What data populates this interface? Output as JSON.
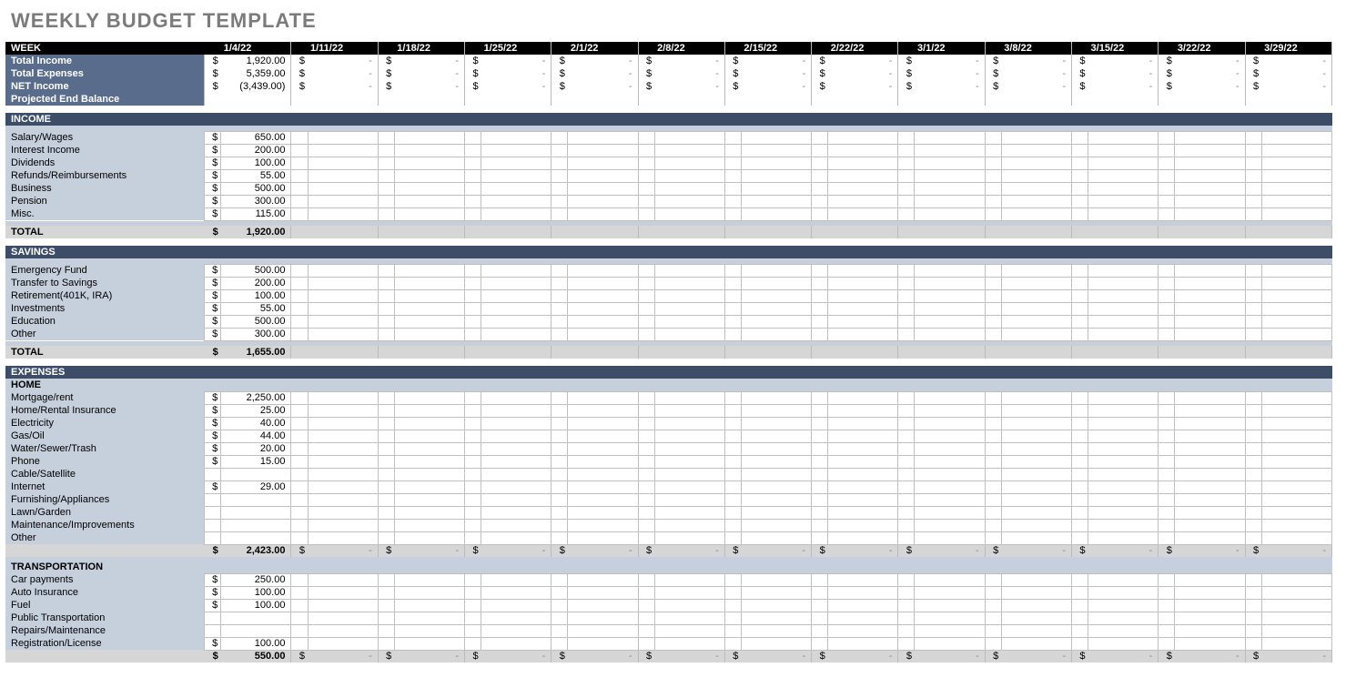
{
  "title": "WEEKLY BUDGET TEMPLATE",
  "weeks": [
    "1/4/22",
    "1/11/22",
    "1/18/22",
    "1/25/22",
    "2/1/22",
    "2/8/22",
    "2/15/22",
    "2/22/22",
    "3/1/22",
    "3/8/22",
    "3/15/22",
    "3/22/22",
    "3/29/22"
  ],
  "summary": {
    "week": "WEEK",
    "rows": [
      {
        "label": "Total Income",
        "vals": [
          "1,920.00",
          "-",
          "-",
          "-",
          "-",
          "-",
          "-",
          "-",
          "-",
          "-",
          "-",
          "-",
          "-"
        ]
      },
      {
        "label": "Total Expenses",
        "vals": [
          "5,359.00",
          "-",
          "-",
          "-",
          "-",
          "-",
          "-",
          "-",
          "-",
          "-",
          "-",
          "-",
          "-"
        ]
      },
      {
        "label": "NET Income",
        "vals": [
          "(3,439.00)",
          "-",
          "-",
          "-",
          "-",
          "-",
          "-",
          "-",
          "-",
          "-",
          "-",
          "-",
          "-"
        ]
      },
      {
        "label": "Projected End Balance"
      }
    ]
  },
  "sections": [
    {
      "title": "INCOME",
      "rows": [
        {
          "label": "Salary/Wages",
          "val": "650.00"
        },
        {
          "label": "Interest Income",
          "val": "200.00"
        },
        {
          "label": "Dividends",
          "val": "100.00"
        },
        {
          "label": "Refunds/Reimbursements",
          "val": "55.00"
        },
        {
          "label": "Business",
          "val": "500.00"
        },
        {
          "label": "Pension",
          "val": "300.00"
        },
        {
          "label": "Misc.",
          "val": "115.00"
        }
      ],
      "total_label": "TOTAL",
      "total": "1,920.00"
    },
    {
      "title": "SAVINGS",
      "rows": [
        {
          "label": "Emergency Fund",
          "val": "500.00"
        },
        {
          "label": "Transfer to Savings",
          "val": "200.00"
        },
        {
          "label": "Retirement(401K, IRA)",
          "val": "100.00"
        },
        {
          "label": "Investments",
          "val": "55.00"
        },
        {
          "label": "Education",
          "val": "500.00"
        },
        {
          "label": "Other",
          "val": "300.00"
        }
      ],
      "total_label": "TOTAL",
      "total": "1,655.00"
    }
  ],
  "expenses": {
    "title": "EXPENSES",
    "groups": [
      {
        "title": "HOME",
        "rows": [
          {
            "label": "Mortgage/rent",
            "val": "2,250.00"
          },
          {
            "label": "Home/Rental Insurance",
            "val": "25.00"
          },
          {
            "label": "Electricity",
            "val": "40.00"
          },
          {
            "label": "Gas/Oil",
            "val": "44.00"
          },
          {
            "label": "Water/Sewer/Trash",
            "val": "20.00"
          },
          {
            "label": "Phone",
            "val": "15.00"
          },
          {
            "label": "Cable/Satellite",
            "val": ""
          },
          {
            "label": "Internet",
            "val": "29.00"
          },
          {
            "label": "Furnishing/Appliances",
            "val": ""
          },
          {
            "label": "Lawn/Garden",
            "val": ""
          },
          {
            "label": "Maintenance/Improvements",
            "val": ""
          },
          {
            "label": "Other",
            "val": ""
          }
        ],
        "subtotal": "2,423.00",
        "dashCols": 12
      },
      {
        "title": "TRANSPORTATION",
        "rows": [
          {
            "label": "Car payments",
            "val": "250.00"
          },
          {
            "label": "Auto Insurance",
            "val": "100.00"
          },
          {
            "label": "Fuel",
            "val": "100.00"
          },
          {
            "label": "Public Transportation",
            "val": ""
          },
          {
            "label": "Repairs/Maintenance",
            "val": ""
          },
          {
            "label": "Registration/License",
            "val": "100.00"
          }
        ],
        "subtotal": "550.00",
        "dashCols": 12
      }
    ]
  },
  "sym": "$",
  "dash": "-"
}
